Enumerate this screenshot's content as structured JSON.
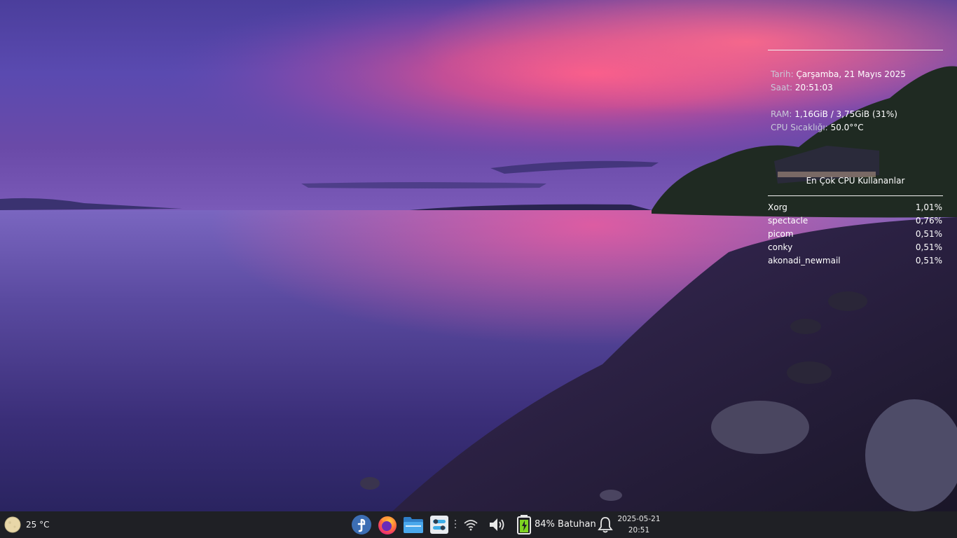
{
  "conky": {
    "date_label": "Tarih:",
    "date_value": "Çarşamba, 21 Mayıs 2025",
    "time_label": "Saat:",
    "time_value": "20:51:03",
    "ram_label": "RAM:",
    "ram_value": "1,16GiB / 3,75GiB (31%)",
    "cpu_temp_label": "CPU Sıcaklığı:",
    "cpu_temp_value": "50.0°°C",
    "top_cpu_title": "En Çok CPU Kullananlar",
    "processes": [
      {
        "name": "Xorg",
        "cpu": "1,01%"
      },
      {
        "name": "spectacle",
        "cpu": "0,76%"
      },
      {
        "name": "picom",
        "cpu": "0,51%"
      },
      {
        "name": "conky",
        "cpu": "0,51%"
      },
      {
        "name": "akonadi_newmail",
        "cpu": "0,51%"
      }
    ]
  },
  "taskbar": {
    "weather": {
      "icon": "moon-icon",
      "temperature": "25 °C"
    },
    "apps": [
      {
        "name": "fedora-launcher",
        "icon": "fedora-icon"
      },
      {
        "name": "firefox",
        "icon": "firefox-icon"
      },
      {
        "name": "file-manager",
        "icon": "folder-icon"
      },
      {
        "name": "system-settings",
        "icon": "settings-icon"
      }
    ],
    "tray": {
      "wifi_icon": "wifi-icon",
      "volume_icon": "volume-icon",
      "battery_icon": "battery-charging-icon",
      "battery_text": "84% Batuhan",
      "notifications_icon": "bell-icon"
    },
    "clock": {
      "date": "2025-05-21",
      "time": "20:51"
    }
  },
  "colors": {
    "taskbar_bg": "#1f2025",
    "fedora_blue": "#3c6eb4",
    "firefox_orange": "#ff7139",
    "folder_blue": "#3d9ae0",
    "battery_green": "#7ed321"
  }
}
